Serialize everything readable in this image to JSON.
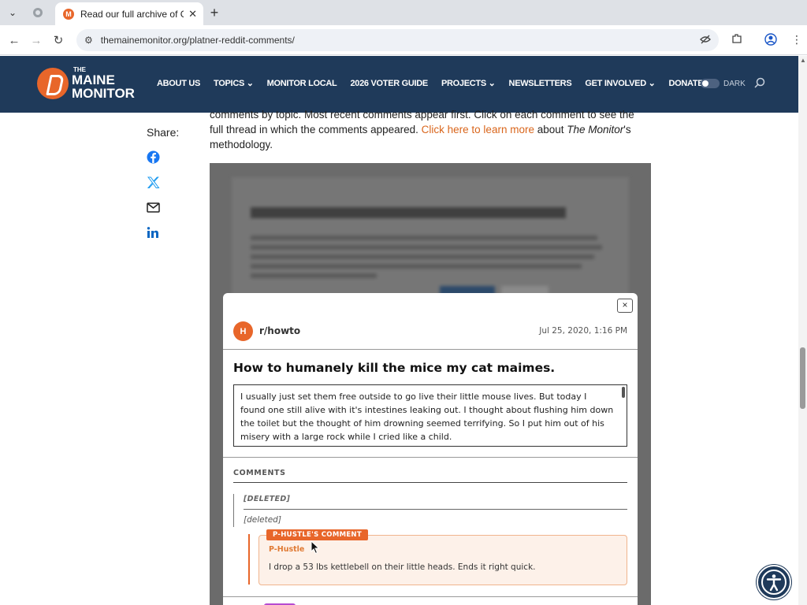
{
  "browser": {
    "tab_title": "Read our full archive of Graham",
    "address": "themainemonitor.org/platner-reddit-comments/"
  },
  "site": {
    "logo": {
      "the": "THE",
      "maine": "MAINE",
      "monitor": "MONITOR"
    },
    "nav": [
      {
        "label": "ABOUT US"
      },
      {
        "label": "TOPICS ⌄"
      },
      {
        "label": "MONITOR LOCAL"
      },
      {
        "label": "2026 VOTER GUIDE"
      },
      {
        "label": "PROJECTS ⌄"
      },
      {
        "label": "NEWSLETTERS"
      },
      {
        "label": "GET INVOLVED ⌄"
      },
      {
        "label": "DONATE"
      }
    ],
    "dark_label": "DARK",
    "brand_color": "#1f3a5a",
    "accent_color": "#e8662a"
  },
  "page": {
    "share_label": "Share:",
    "share_icons": [
      "facebook-icon",
      "x-icon",
      "email-icon",
      "linkedin-icon"
    ],
    "intro_line1": "comments by topic. Most recent comments appear first. Click on each comment to see the",
    "intro_line2_pre": "full thread in which the comments appeared. ",
    "intro_link": "Click here to learn more",
    "intro_line2_mid": " about ",
    "intro_em": "The Monitor",
    "intro_line2_post": "'s",
    "intro_line3": "methodology."
  },
  "modal": {
    "close_label": "×",
    "avatar_letter": "H",
    "subreddit": "r/howto",
    "date": "Jul 25, 2020, 1:16 PM",
    "title": "How to humanely kill the mice my cat maimes.",
    "body": "I usually just set them free outside to go live their little mouse lives. But today I found one still alive with it's intestines leaking out. I thought about flushing him down the toilet but the thought of him drowning seemed terrifying. So I put him out of his misery with a large rock while I cried like a child.",
    "comments_heading": "COMMENTS",
    "deleted_author": "[DELETED]",
    "deleted_body": "[deleted]",
    "reply_badge": "P-HUSTLE'S COMMENT",
    "reply_author": "P-Hustle",
    "reply_text": "I drop a 53 lbs kettlebell on their little heads. Ends it right quick."
  }
}
